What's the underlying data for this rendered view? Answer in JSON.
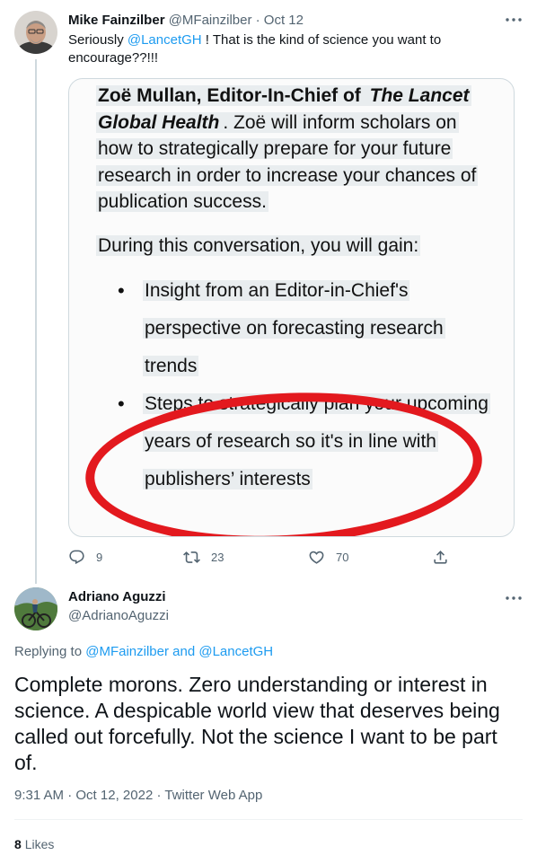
{
  "tweet1": {
    "name": "Mike Fainzilber",
    "handle": "@MFainzilber",
    "separator": "·",
    "date": "Oct 12",
    "text_before": "Seriously ",
    "mention": "@LancetGH",
    "text_after": "  !  That is the kind of science you want to encourage??!!!",
    "media": {
      "lead_bold": "Zoë Mullan, Editor-In-Chief of ",
      "lead_italic": "The Lancet Global Health",
      "lead_rest": ". Zoë will inform scholars on how to strategically prepare for your future research in order to increase your chances of publication success.",
      "gain_heading": "During this conversation, you will gain:",
      "bullets": [
        "Insight from an Editor-in-Chief's perspective on forecasting research trends",
        "Steps to strategically plan your upcoming years of research so it's in line with publishers’ interests"
      ],
      "highlight_color": "#e3191e"
    },
    "actions": {
      "replies": "9",
      "retweets": "23",
      "likes": "70"
    }
  },
  "tweet2": {
    "name": "Adriano Aguzzi",
    "handle": "@AdrianoAguzzi",
    "replying_prefix": "Replying to ",
    "replying_user1": "@MFainzilber",
    "replying_and": " and ",
    "replying_user2": "@LancetGH",
    "text": "Complete morons. Zero understanding or interest in science. A despicable world view that deserves being called out forcefully. Not the science I want to be part of.",
    "time": "9:31 AM",
    "separator": "·",
    "date": "Oct 12, 2022",
    "source": "Twitter Web App",
    "like_count": "8",
    "like_label": "Likes"
  },
  "colors": {
    "link": "#1d9bf0",
    "muted": "#536471",
    "text": "#0f1419"
  }
}
